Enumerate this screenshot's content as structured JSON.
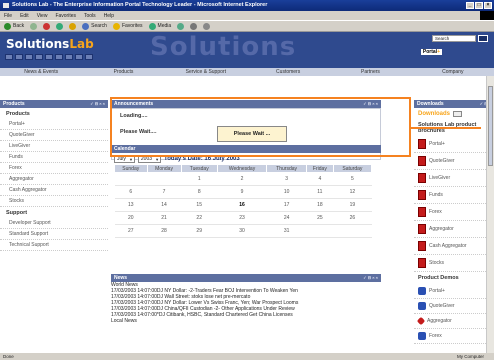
{
  "window": {
    "title": "Solutions Lab - The Enterprise Information Portal Technology Leader - Microsoft Internet Explorer",
    "buttons": [
      "_",
      "□",
      "×"
    ]
  },
  "menubar": {
    "items": [
      "File",
      "Edit",
      "View",
      "Favorites",
      "Tools",
      "Help"
    ]
  },
  "toolbar": {
    "back": "Back",
    "search": "Search",
    "favorites": "Favorites",
    "media": "Media"
  },
  "site": {
    "logo_main": "Solutions",
    "logo_accent": "Lab",
    "bg_word": "Solutions",
    "search_value": "Search",
    "portal_label_main": "Portal",
    "portal_label_accent": "+"
  },
  "nav": {
    "items": [
      "News & Events",
      "Products",
      "Service & Support",
      "Customers",
      "Partners",
      "Company"
    ]
  },
  "left": {
    "panel_title": "Products",
    "sections": [
      {
        "title": "Products",
        "items": [
          "Portal+",
          "QuoteGiver",
          "LiveGiver",
          "Funds",
          "Forex",
          "Aggregator",
          "Cash Aggregator",
          "Stocks"
        ]
      },
      {
        "title": "Support",
        "items": [
          "Developer Support",
          "Standard Support",
          "Technical Support"
        ]
      }
    ]
  },
  "announce": {
    "title": "Announcements",
    "loading": "Loading....",
    "wait": "Please Wait....",
    "dialog": "Please Wait ..."
  },
  "calendar": {
    "title": "Calendar",
    "month": "July",
    "year": "2003",
    "today_text": "Today's Date: 16 July 2003",
    "headers": [
      "Sunday",
      "Monday",
      "Tuesday",
      "Wednesday",
      "Thursday",
      "Friday",
      "Saturday"
    ],
    "weeks": [
      [
        "",
        "",
        "1",
        "2",
        "3",
        "4",
        "5"
      ],
      [
        "6",
        "7",
        "8",
        "9",
        "10",
        "11",
        "12"
      ],
      [
        "13",
        "14",
        "15",
        "16",
        "17",
        "18",
        "19"
      ],
      [
        "20",
        "21",
        "22",
        "23",
        "24",
        "25",
        "26"
      ],
      [
        "27",
        "28",
        "29",
        "30",
        "31",
        "",
        ""
      ]
    ]
  },
  "news": {
    "title": "News",
    "subtitle": "World News",
    "rows": [
      {
        "d": "17/03/2003 14:07:00",
        "h": "DJ NY Dollar: -2-Traders Fear BOJ Intervention To Weaken Yen"
      },
      {
        "d": "17/03/2003 14:07:00",
        "h": "DJ Wall Street: stoks lose net pre-mercato"
      },
      {
        "d": "17/03/2003 14:07:00",
        "h": "DJ NY Dollar: Lower Vs Swiss Franc, Yen; War Prospect Looms"
      },
      {
        "d": "17/03/2003 14:07:00",
        "h": "DJ China/QFII Custodian -2- Other Applications Under Review"
      },
      {
        "d": "17/03/2003 14:07:00",
        "h": "*DJ Citibank, HSBC, Standard Chartered Get China Licenses"
      }
    ],
    "local": "Local News"
  },
  "right": {
    "panel_title": "Downloads",
    "downloads_label": "Downloads",
    "brochures_title": "Solutions Lab product brochures",
    "brochures": [
      "Portal+",
      "QuoteGiver",
      "LiveGiver",
      "Funds",
      "Forex",
      "Aggregator",
      "Cash Aggregator",
      "Stocks"
    ],
    "demos_title": "Product Demos",
    "demos": [
      "Portal+",
      "QuoteGiver",
      "Aggregator",
      "Forex"
    ]
  },
  "status": {
    "left": "Done",
    "right": "My Computer"
  },
  "colors": {
    "accent": "#f58220",
    "nav_blue": "#2f4a8e",
    "panel_head": "#5d6fa0"
  }
}
